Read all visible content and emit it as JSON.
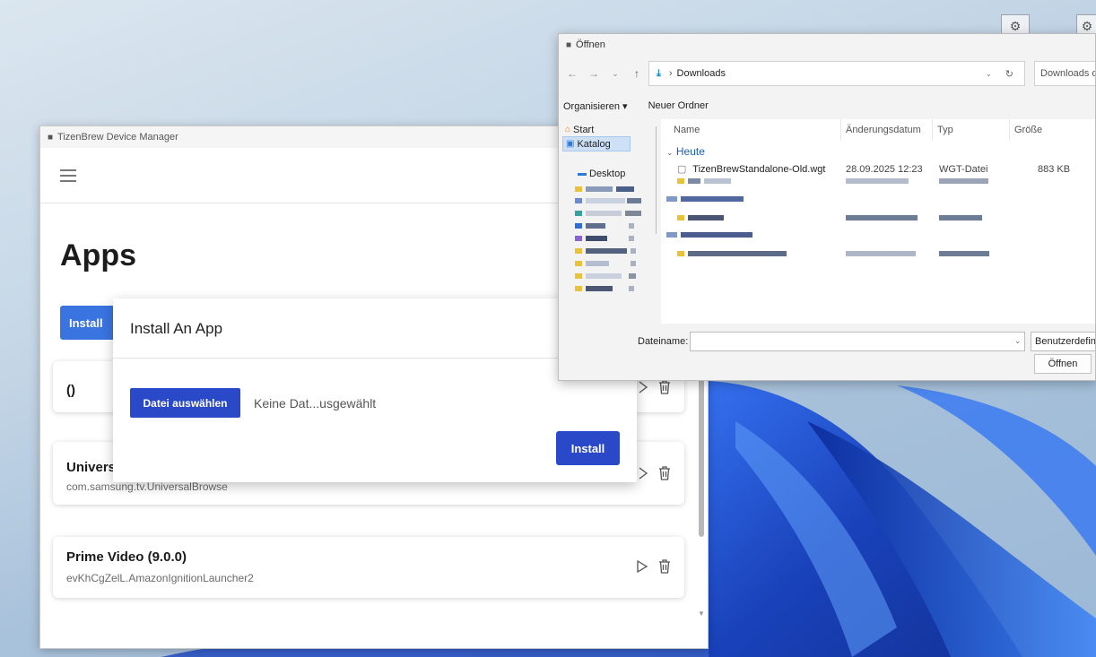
{
  "colors": {
    "primary": "#2a49c9",
    "install_bg": "#3a74e0",
    "wallpaper_blue": "#1f4fd6"
  },
  "device_manager": {
    "window_title": "TizenBrew Device Manager",
    "page_title": "Apps",
    "install_label": "Install",
    "apps": [
      {
        "name": "()",
        "package": ""
      },
      {
        "name": "Univers",
        "package": "com.samsung.tv.UniversalBrowse"
      },
      {
        "name": "Prime Video (9.0.0)",
        "package": "evKhCgZelL.AmazonIgnitionLauncher2"
      }
    ],
    "modal": {
      "title": "Install An App",
      "file_button": "Datei auswählen",
      "file_status": "Keine Dat...usgewählt",
      "install_button": "Install"
    }
  },
  "open_dialog": {
    "title": "Öffnen",
    "breadcrumb": "Downloads",
    "search_placeholder": "Downloads d",
    "toolbar": {
      "organize": "Organisieren ▾",
      "new_folder": "Neuer Ordner"
    },
    "nav": {
      "start": "Start",
      "gallery": "Katalog",
      "desktop": "Desktop"
    },
    "columns": {
      "name": "Name",
      "date": "Änderungsdatum",
      "type": "Typ",
      "size": "Größe"
    },
    "group_today": "Heute",
    "file": {
      "name": "TizenBrewStandalone-Old.wgt",
      "date": "28.09.2025 12:23",
      "type": "WGT-Datei",
      "size": "883 KB"
    },
    "filename_label": "Dateiname:",
    "filetype": "Benutzerdefin",
    "open_button": "Öffnen"
  }
}
